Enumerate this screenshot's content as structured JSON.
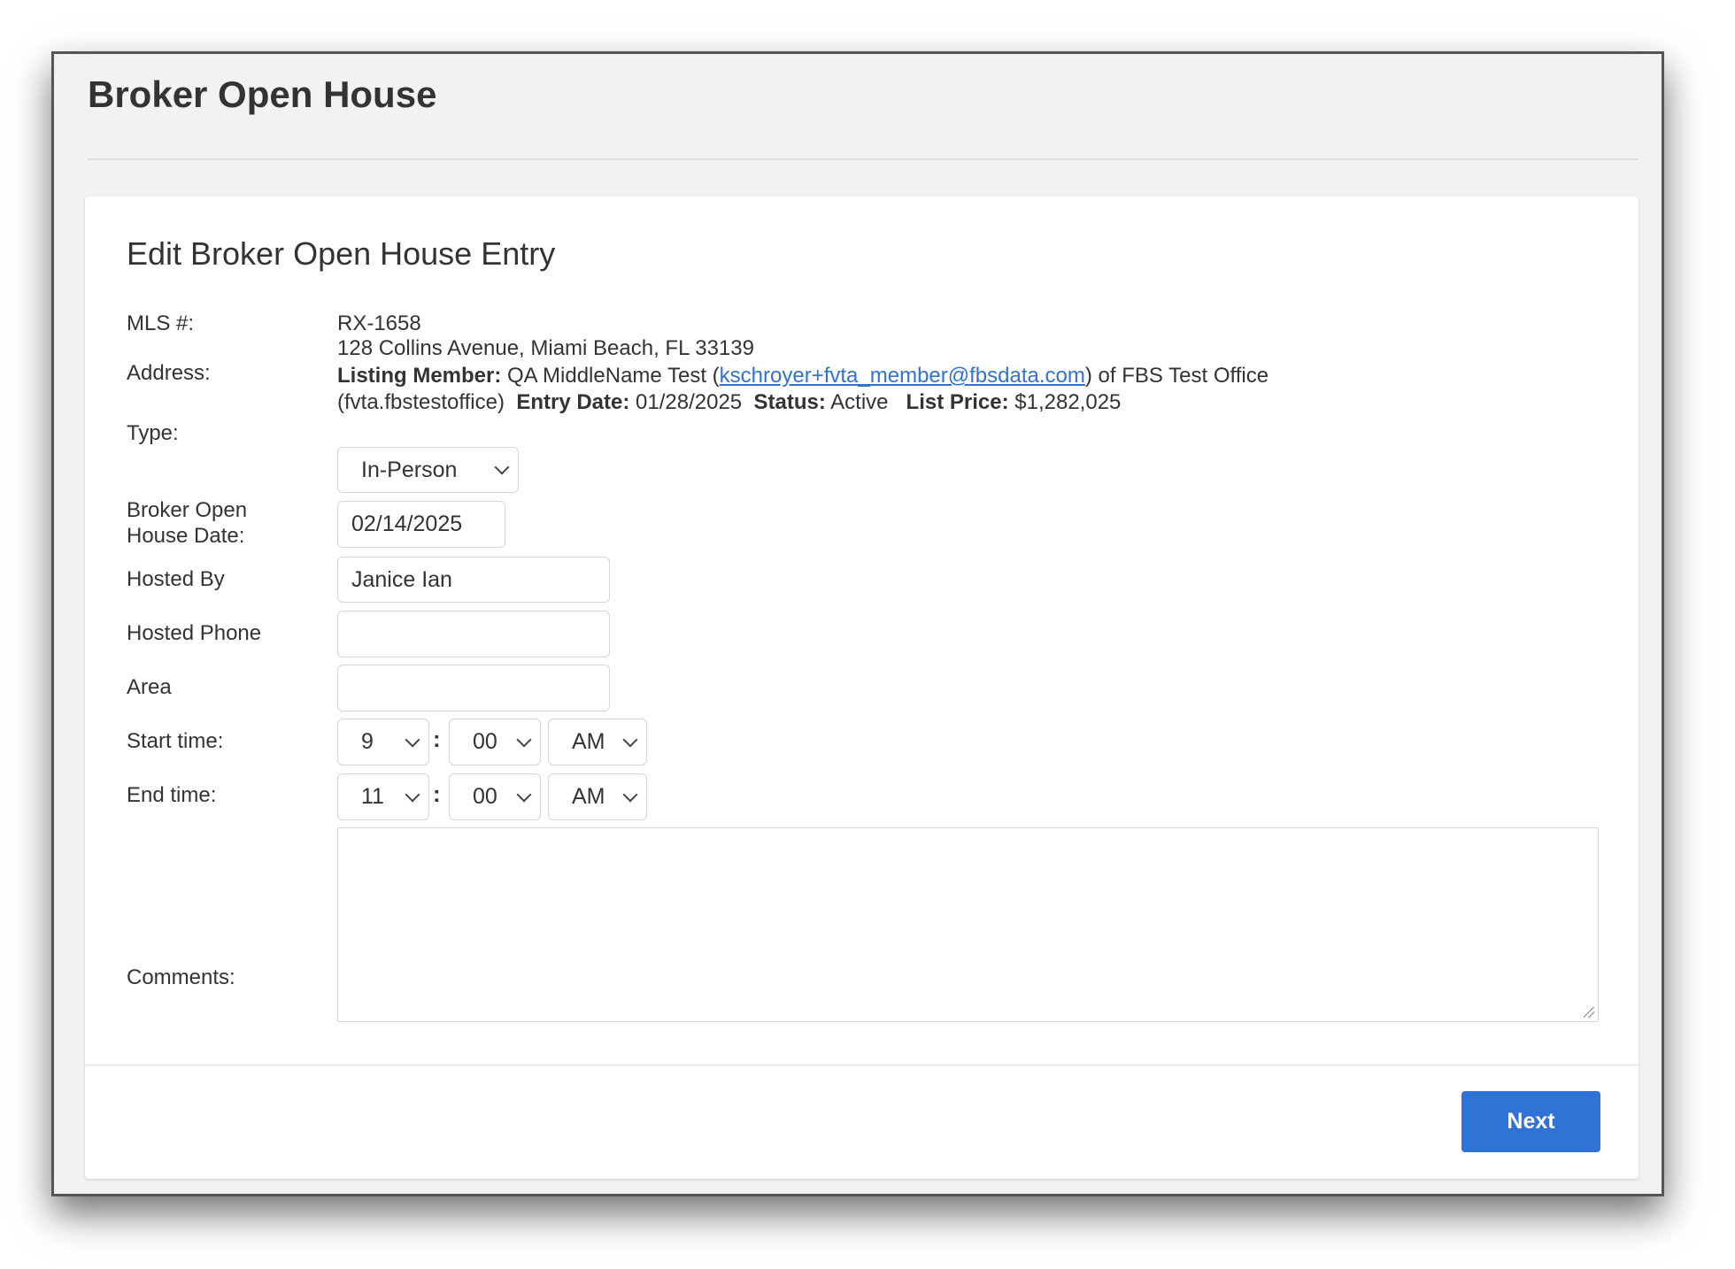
{
  "window": {
    "title": "Broker Open House"
  },
  "form": {
    "heading": "Edit Broker Open House Entry",
    "mls_label": "MLS #:",
    "mls_value": "RX-1658",
    "address_label": "Address:",
    "address_value": "128 Collins Avenue, Miami Beach, FL 33139",
    "listing_member_label": "Listing Member:",
    "listing_member_name": "QA MiddleName Test (",
    "listing_member_email": "kschroyer+fvta_member@fbsdata.com",
    "listing_member_office": ") of FBS Test Office (fvta.fbstestoffice)",
    "entry_date_label": "Entry Date:",
    "entry_date": "01/28/2025",
    "status_label": "Status:",
    "status": "Active",
    "list_price_label": "List Price:",
    "list_price": "$1,282,025",
    "type_label": "Type:",
    "type_value": "In-Person",
    "date_label": "Broker Open House Date:",
    "date_value": "02/14/2025",
    "hosted_by_label": "Hosted By",
    "hosted_by_value": "Janice Ian",
    "hosted_phone_label": "Hosted Phone",
    "hosted_phone_value": "",
    "area_label": "Area",
    "area_value": "",
    "start_label": "Start time:",
    "start_hour": "9",
    "start_minute": "00",
    "start_ampm": "AM",
    "end_label": "End time:",
    "end_hour": "11",
    "end_minute": "00",
    "end_ampm": "AM",
    "colon": ":",
    "comments_label": "Comments:",
    "comments_value": "",
    "next_label": "Next"
  },
  "colors": {
    "accent": "#2f73d6"
  }
}
